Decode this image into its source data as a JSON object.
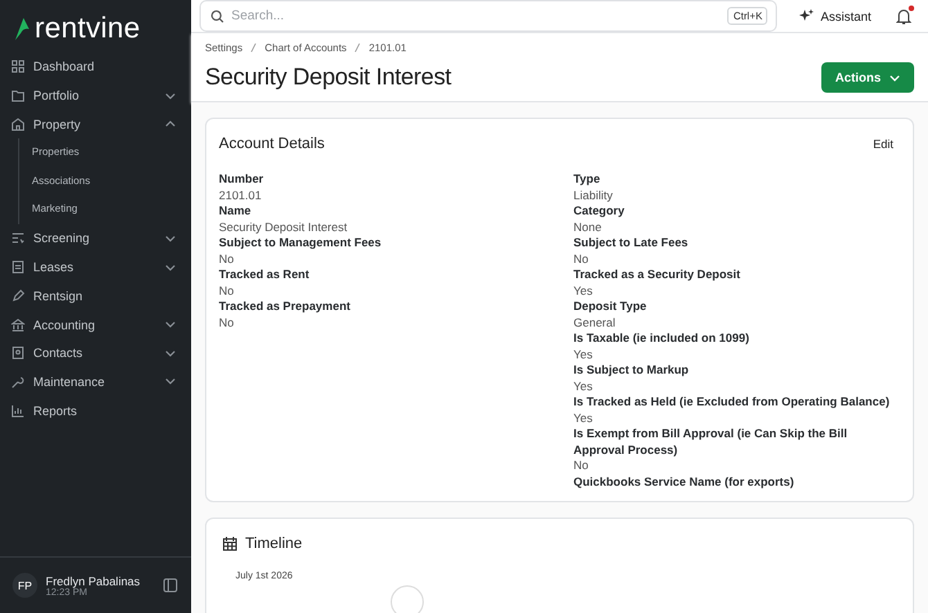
{
  "sidebar": {
    "brand": "rentvine",
    "items": [
      {
        "label": "Dashboard"
      },
      {
        "label": "Portfolio",
        "expanded": false
      },
      {
        "label": "Property",
        "expanded": true,
        "children": [
          {
            "label": "Properties"
          },
          {
            "label": "Associations"
          },
          {
            "label": "Marketing"
          }
        ]
      },
      {
        "label": "Screening",
        "expanded": false
      },
      {
        "label": "Leases",
        "expanded": false
      },
      {
        "label": "Rentsign"
      },
      {
        "label": "Accounting",
        "expanded": false
      },
      {
        "label": "Contacts",
        "expanded": false
      },
      {
        "label": "Maintenance",
        "expanded": false
      },
      {
        "label": "Reports"
      }
    ],
    "user": {
      "initials": "FP",
      "name": "Fredlyn Pabalinas",
      "time": "12:23 PM"
    }
  },
  "topbar": {
    "search": {
      "placeholder": "Search..."
    },
    "shortcut": "Ctrl+K",
    "assistant": "Assistant",
    "notification": true
  },
  "breadcrumbs": [
    "Settings",
    "Chart of Accounts",
    "2101.01"
  ],
  "title": "Security Deposit Interest",
  "actions_button": "Actions",
  "account_details": {
    "title": "Account Details",
    "edit": "Edit",
    "left_fields": [
      {
        "label": "Number",
        "value": "2101.01"
      },
      {
        "label": "Name",
        "value": "Security Deposit Interest"
      },
      {
        "label": "Subject to Management Fees",
        "value": "No"
      },
      {
        "label": "Tracked as Rent",
        "value": "No"
      },
      {
        "label": "Tracked as Prepayment",
        "value": "No"
      }
    ],
    "right_fields": [
      {
        "label": "Type",
        "value": "Liability"
      },
      {
        "label": "Category",
        "value": "None"
      },
      {
        "label": "Subject to Late Fees",
        "value": "No"
      },
      {
        "label": "Tracked as a Security Deposit",
        "value": "Yes"
      },
      {
        "label": "Deposit Type",
        "value": "General"
      },
      {
        "label": "Is Taxable (ie included on 1099)",
        "value": "Yes"
      },
      {
        "label": "Is Subject to Markup",
        "value": "Yes"
      },
      {
        "label": "Is Tracked as Held (ie Excluded from Operating Balance)",
        "value": "Yes"
      },
      {
        "label": "Is Exempt from Bill Approval (ie Can Skip the Bill Approval Process)",
        "value": "No"
      },
      {
        "label": "Quickbooks Service Name (for exports)"
      }
    ]
  },
  "timeline": {
    "title": "Timeline",
    "entries": [
      {
        "date": "July 1st 2026"
      }
    ]
  }
}
